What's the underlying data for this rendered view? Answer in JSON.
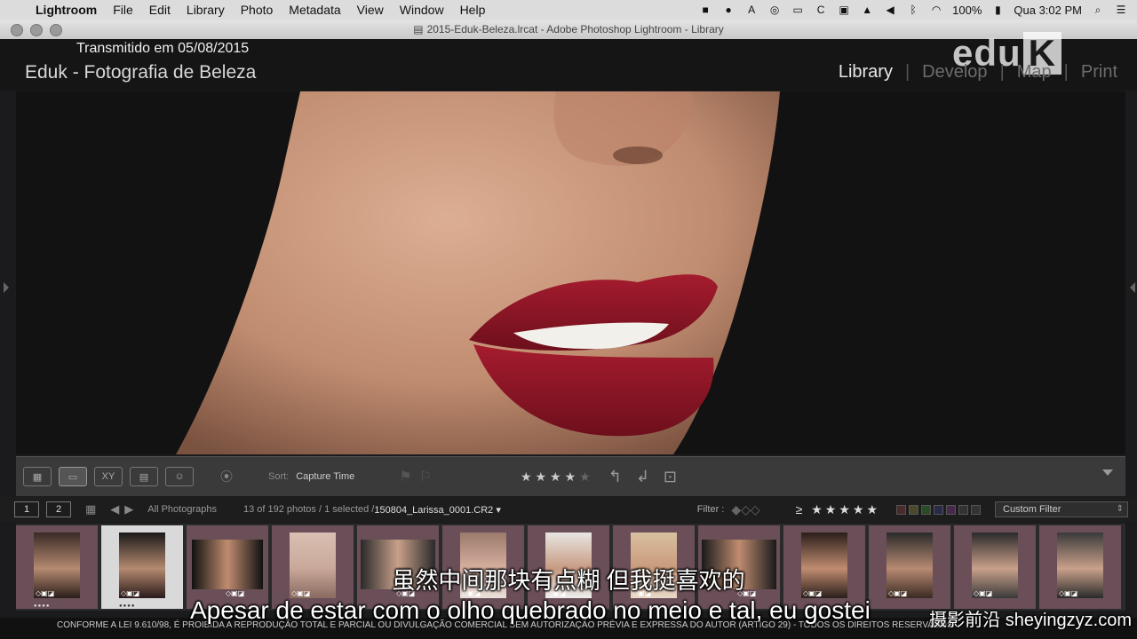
{
  "menubar": {
    "apple_icon": "apple-icon",
    "items": [
      "Lightroom",
      "File",
      "Edit",
      "Library",
      "Photo",
      "Metadata",
      "View",
      "Window",
      "Help"
    ],
    "battery": "100%",
    "clock": "Qua 3:02 PM"
  },
  "window": {
    "title": "2015-Eduk-Beleza.lrcat - Adobe Photoshop Lightroom - Library"
  },
  "header": {
    "broadcast_note": "Transmitido em 05/08/2015",
    "identity_plate": "Eduk - Fotografia de Beleza",
    "logo_text": "edu",
    "logo_k": "K",
    "modules": [
      "Library",
      "Develop",
      "Map",
      "Print"
    ],
    "active_module": "Library"
  },
  "toolbar": {
    "sort_label": "Sort:",
    "sort_value": "Capture Time",
    "rating_filled": "★★★★",
    "rating_empty": "★"
  },
  "filmstrip_bar": {
    "page1": "1",
    "page2": "2",
    "source": "All Photographs",
    "count": "13 of 192 photos / 1 selected /",
    "filename": "150804_Larissa_0001.CR2 ▾",
    "filter_label": "Filter :",
    "filter_stars": "≥ ★★★★★",
    "custom_filter": "Custom Filter"
  },
  "subtitles": {
    "chinese": "虽然中间那块有点糊 但我挺喜欢的",
    "portuguese": "Apesar de estar com o olho quebrado no meio e tal, eu gostei"
  },
  "legal_text": "CONFORME A LEI 9.610/98, É PROIBIDA A REPRODUÇÃO TOTAL E PARCIAL OU DIVULGAÇÃO COMERCIAL SEM AUTORIZAÇÃO PRÉVIA E EXPRESSA DO AUTOR (ARTIGO 29) - TODOS OS DIREITOS RESERVADOS",
  "watermark": "摄影前沿 sheyingzyz.com",
  "colors": {
    "lip": "#8e1424",
    "skin": "#c9957a",
    "thumb_frame": "#6b4f58"
  }
}
